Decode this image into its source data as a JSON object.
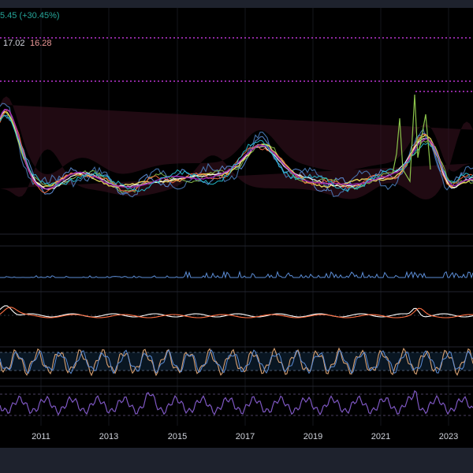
{
  "legend": {
    "change_text": "5.45 (+30.45%)",
    "value_1": "17.02",
    "value_2": "16.28"
  },
  "x_axis": {
    "labels": [
      "2011",
      "2013",
      "2015",
      "2017",
      "2019",
      "2021",
      "2023"
    ]
  },
  "colors": {
    "background": "#000000",
    "chrome": "#1e222d",
    "up_text": "#26a69a",
    "value_text": "#d1d4dc",
    "pink_text": "#ef9a9a",
    "dotted_line": "#e040fb",
    "rsi_purple": "#7e57c2",
    "stoch_orange": "#d8a070",
    "stoch_blue": "#5c8dd6"
  }
}
